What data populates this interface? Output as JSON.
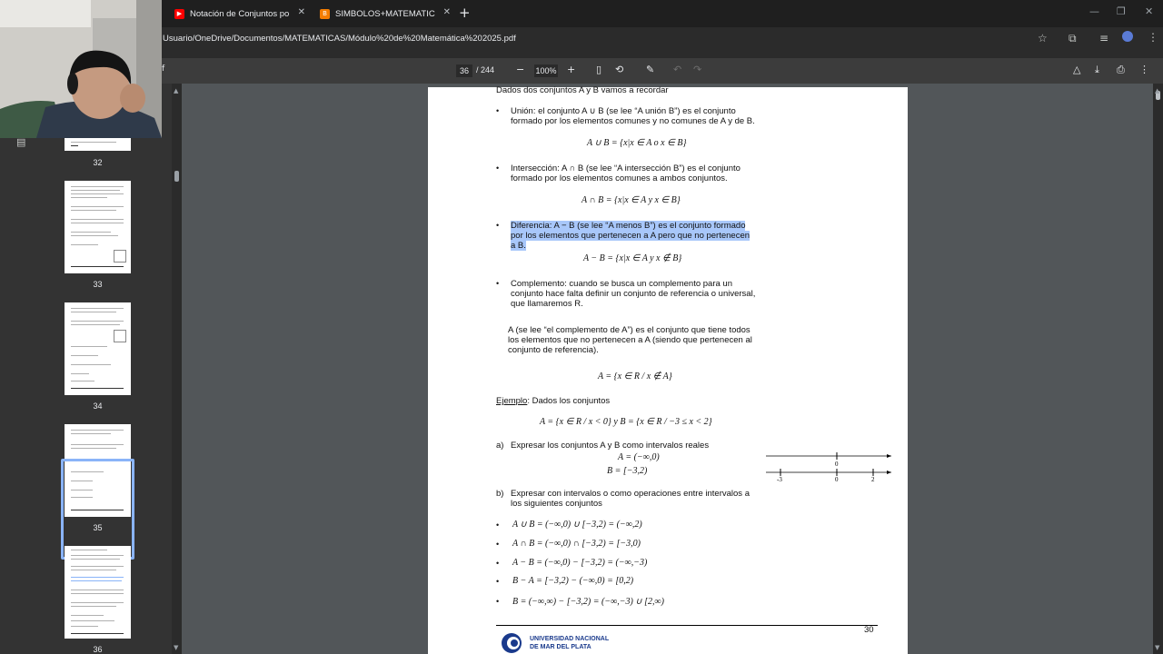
{
  "tabs": [
    {
      "title": "Notación de Conjuntos por Ext",
      "favicon": "youtube-icon",
      "color": "#ff0000"
    },
    {
      "title": "SIMBOLOS+MATEMATICOS.pn",
      "favicon": "blogger-icon",
      "color": "#f57d00"
    }
  ],
  "address": {
    "url": "Usuario/OneDrive/Documentos/MATEMATICAS/Módulo%20de%20Matemática%202025.pdf"
  },
  "pdf_toolbar": {
    "page_current": "36",
    "page_total": "/ 244",
    "zoom": "100%"
  },
  "thumbnails": [
    {
      "label": "32"
    },
    {
      "label": "33"
    },
    {
      "label": "34"
    },
    {
      "label": "35"
    },
    {
      "label": "36"
    }
  ],
  "doc": {
    "intro": "Dados dos conjuntos A y B vamos a recordar",
    "union_1": "Unión: el conjunto  A ∪ B  (se lee “A unión B”) es el conjunto",
    "union_2": "formado por los elementos comunes y no comunes de A y de B.",
    "union_formula": "A ∪ B = {x|x ∈ A o x ∈ B}",
    "inter_1": "Intersección:  A ∩ B  (se lee “A intersección B”) es el conjunto",
    "inter_2": "formado por los elementos comunes a ambos conjuntos.",
    "inter_formula": "A ∩ B = {x|x ∈ A   y   x ∈ B}",
    "diff_1": "Diferencia: A − B  (se lee “A menos B”) es el conjunto formado",
    "diff_2": "por los elementos que pertenecen a A pero que no pertenecen",
    "diff_3": "a B.",
    "diff_formula": "A − B = {x|x ∈ A   y   x ∉ B}",
    "comp_1": "Complemento: cuando se busca un complemento para un",
    "comp_2": "conjunto hace falta definir un conjunto de referencia o universal,",
    "comp_3": "que llamaremos R.",
    "compdef_1": "A  (se lee “el complemento de A”) es el conjunto que tiene todos",
    "compdef_2": "los elementos que no pertenecen a A (siendo que pertenecen al",
    "compdef_3": "conjunto de referencia).",
    "comp_formula": "A = {x ∈ R / x ∉ A}",
    "ejemplo_label": "Ejemplo",
    "ejemplo_rest": ": Dados los conjuntos",
    "sets_formula": "A = {x ∈ R / x < 0}  y  B = {x ∈ R / −3 ≤ x < 2}",
    "a_label": "a)",
    "a_text": "Expresar los conjuntos A y B como intervalos reales",
    "a_A": "A = (−∞,0)",
    "a_B": "B = [−3,2)",
    "b_label": "b)",
    "b_text_1": "Expresar con intervalos o como operaciones entre intervalos a",
    "b_text_2": "los siguientes conjuntos",
    "ops": [
      "A ∪ B = (−∞,0) ∪ [−3,2) = (−∞,2)",
      "A ∩ B = (−∞,0) ∩ [−3,2) = [−3,0)",
      "A − B = (−∞,0) − [−3,2) = (−∞,−3)",
      "B − A = [−3,2) − (−∞,0) = [0,2)",
      "B = (−∞,∞) − [−3,2) = (−∞,−3) ∪ [2,∞)"
    ],
    "numline_labels": {
      "zero_top": "0",
      "m3": "-3",
      "zero_bottom": "0",
      "two": "2"
    },
    "page_number": "30",
    "university_1": "UNIVERSIDAD   NACIONAL",
    "university_2": "DE MAR DEL PLATA"
  }
}
